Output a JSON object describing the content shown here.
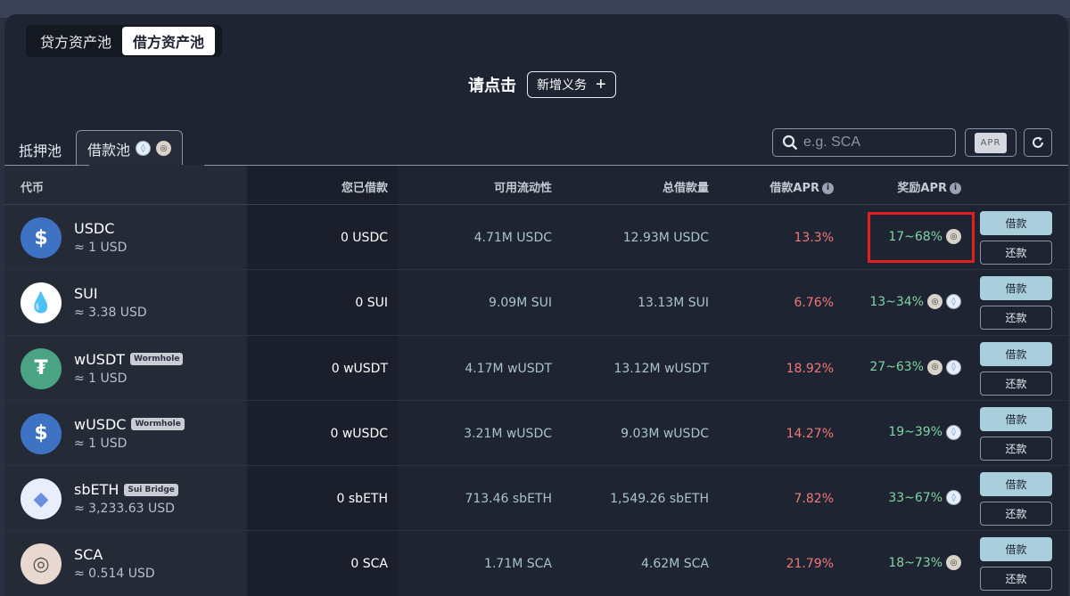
{
  "pool_switch": {
    "lend": "贷方资产池",
    "borrow": "借方资产池"
  },
  "prompt": {
    "text": "请点击",
    "add_button": "新增义务"
  },
  "subtabs": {
    "collateral": "抵押池",
    "borrow": "借款池"
  },
  "search": {
    "placeholder": "e.g. SCA"
  },
  "apr_toggle": "APR",
  "columns": {
    "token": "代币",
    "borrowed": "您已借款",
    "liquidity": "可用流动性",
    "total": "总借款量",
    "apr": "借款APR",
    "reward": "奖励APR"
  },
  "buttons": {
    "borrow": "借款",
    "repay": "还款"
  },
  "rows": [
    {
      "name": "USDC",
      "badge": "",
      "price": "≈ 1 USD",
      "borrowed": "0 USDC",
      "liquidity": "4.71M USDC",
      "total": "12.93M USDC",
      "apr": "13.3%",
      "reward": "17~68%",
      "icon": "usdc-icon",
      "color": "#3e73c4"
    },
    {
      "name": "SUI",
      "badge": "",
      "price": "≈ 3.38 USD",
      "borrowed": "0 SUI",
      "liquidity": "9.09M SUI",
      "total": "13.13M SUI",
      "apr": "6.76%",
      "reward": "13~34%",
      "icon": "sui-icon",
      "color": "#ffffff"
    },
    {
      "name": "wUSDT",
      "badge": "Wormhole",
      "price": "≈ 1 USD",
      "borrowed": "0 wUSDT",
      "liquidity": "4.17M wUSDT",
      "total": "13.12M wUSDT",
      "apr": "18.92%",
      "reward": "27~63%",
      "icon": "usdt-icon",
      "color": "#4aa383"
    },
    {
      "name": "wUSDC",
      "badge": "Wormhole",
      "price": "≈ 1 USD",
      "borrowed": "0 wUSDC",
      "liquidity": "3.21M wUSDC",
      "total": "9.03M wUSDC",
      "apr": "14.27%",
      "reward": "19~39%",
      "icon": "usdc-icon",
      "color": "#3e73c4"
    },
    {
      "name": "sbETH",
      "badge": "Sui Bridge",
      "price": "≈ 3,233.63 USD",
      "borrowed": "0 sbETH",
      "liquidity": "713.46 sbETH",
      "total": "1,549.26 sbETH",
      "apr": "7.82%",
      "reward": "33~67%",
      "icon": "eth-icon",
      "color": "#e8eefb"
    },
    {
      "name": "SCA",
      "badge": "",
      "price": "≈ 0.514 USD",
      "borrowed": "0 SCA",
      "liquidity": "1.71M SCA",
      "total": "4.62M SCA",
      "apr": "21.79%",
      "reward": "18~73%",
      "icon": "sca-icon",
      "color": "#e8d8d0"
    }
  ]
}
